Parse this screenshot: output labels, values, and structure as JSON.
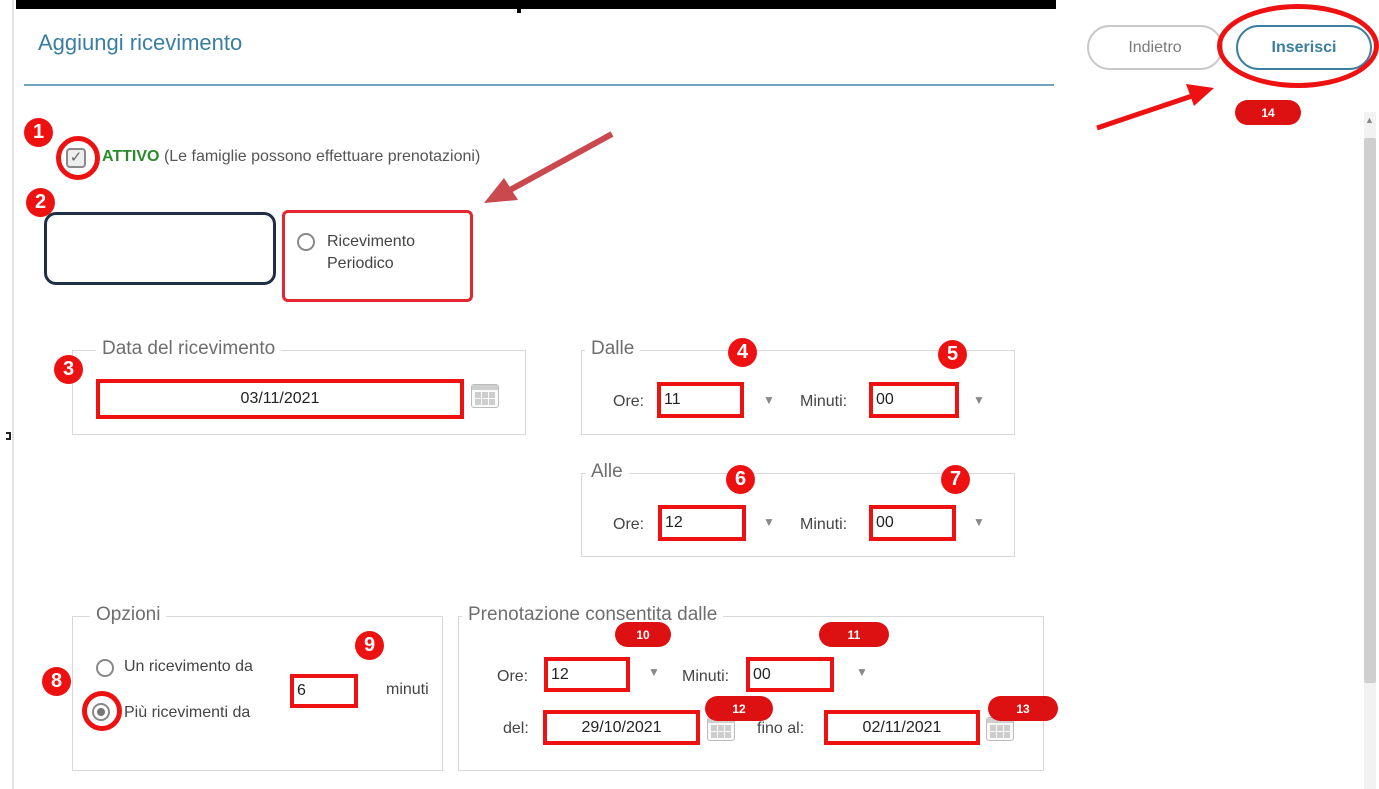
{
  "header": {
    "title": "Aggiungi ricevimento",
    "back_label": "Indietro",
    "insert_label": "Inserisci"
  },
  "active": {
    "checked": true,
    "strong": "ATTIVO",
    "note": "(Le famiglie possono effettuare prenotazioni)"
  },
  "periodic": {
    "label_line1": "Ricevimento",
    "label_line2": "Periodico",
    "selected": false
  },
  "date_section": {
    "legend": "Data del ricevimento",
    "date_value": "03/11/2021"
  },
  "from_section": {
    "legend": "Dalle",
    "hours_label": "Ore:",
    "hours_value": "11",
    "minutes_label": "Minuti:",
    "minutes_value": "00"
  },
  "to_section": {
    "legend": "Alle",
    "hours_label": "Ore:",
    "hours_value": "12",
    "minutes_label": "Minuti:",
    "minutes_value": "00"
  },
  "options": {
    "legend": "Opzioni",
    "single_label": "Un ricevimento da",
    "multi_label": "Più ricevimenti da",
    "selected": "multi",
    "duration_value": "6",
    "duration_unit": "minuti"
  },
  "booking": {
    "legend": "Prenotazione consentita dalle",
    "hours_label": "Ore:",
    "hours_value": "12",
    "minutes_label": "Minuti:",
    "minutes_value": "00",
    "from_label": "del:",
    "from_value": "29/10/2021",
    "to_label": "fino al:",
    "to_value": "02/11/2021"
  },
  "annotations": {
    "markers": [
      "1",
      "2",
      "3",
      "4",
      "5",
      "6",
      "7",
      "8",
      "9",
      "10",
      "11",
      "12",
      "13",
      "14"
    ],
    "color": "#ee1111"
  },
  "colors": {
    "accent": "#3a7fa0",
    "active_green": "#2b8a2b",
    "annotation_red": "#ee1111"
  }
}
